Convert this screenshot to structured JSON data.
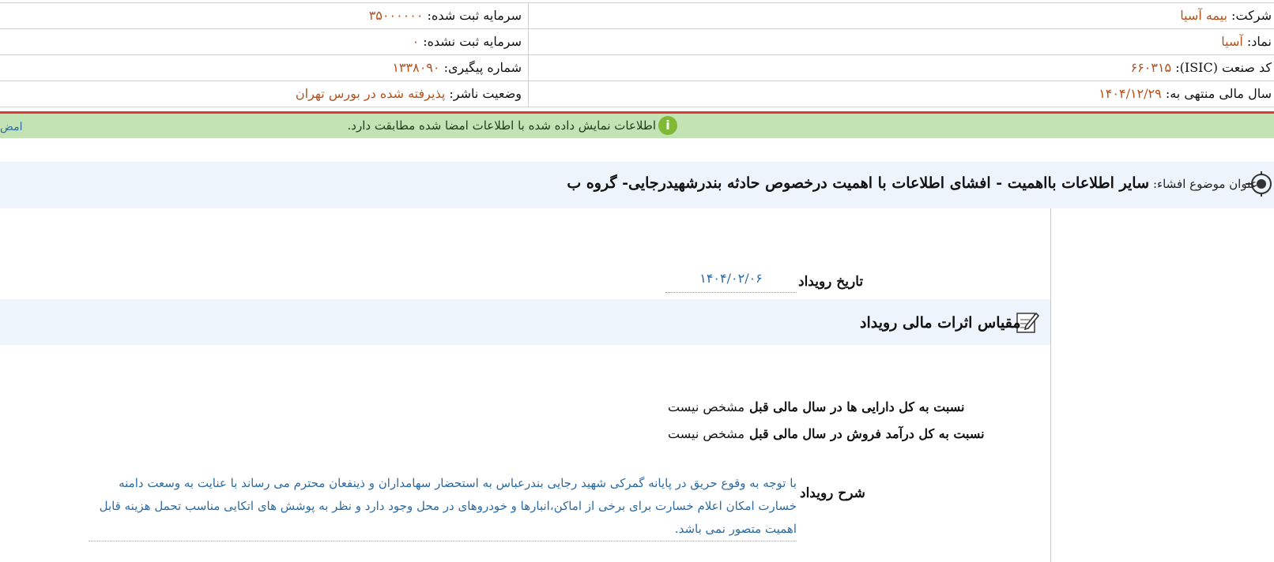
{
  "info": {
    "company_label": "شرکت:",
    "company_value": "بیمه آسیا",
    "symbol_label": "نماد:",
    "symbol_value": "آسیا",
    "isic_label": "کد صنعت (ISIC):",
    "isic_value": "۶۶۰۳۱۵",
    "fiscal_year_label": "سال مالی منتهی به:",
    "fiscal_year_value": "۱۴۰۴/۱۲/۲۹",
    "registered_capital_label": "سرمایه ثبت شده:",
    "registered_capital_value": "۳۵۰۰۰۰۰۰",
    "unregistered_capital_label": "سرمایه ثبت نشده:",
    "unregistered_capital_value": "۰",
    "tracking_number_label": "شماره پیگیری:",
    "tracking_number_value": "۱۳۳۸۰۹۰",
    "publisher_status_label": "وضعیت ناشر:",
    "publisher_status_value": "پذیرفته شده در بورس تهران"
  },
  "banner": {
    "text": "اطلاعات نمایش داده شده با اطلاعات امضا شده مطابقت دارد.",
    "side_link": "امض"
  },
  "disclosure": {
    "title_label": "عنوان موضوع افشاء:",
    "title_value": "سایر اطلاعات بااهمیت - افشای اطلاعات با اهمیت درخصوص حادثه بندرشهیدرجایی- گروه ب"
  },
  "event": {
    "date_label": "تاریخ رویداد",
    "date_value": "۱۴۰۴/۰۲/۰۶",
    "section_title": "مقیاس اثرات مالی رویداد",
    "ratio_assets_label": "نسبت به کل دارایی ها در سال مالی قبل",
    "ratio_assets_value": "مشخص نیست",
    "ratio_revenue_label": "نسبت به کل درآمد فروش در سال مالی قبل",
    "ratio_revenue_value": "مشخص نیست",
    "description_label": "شرح رویداد",
    "description_value": "با توجه به وقوع حریق در پایانه گمرکی شهید رجایی بندرعباس به استحضار سهامداران و ذینفعان محترم می رساند با عنایت به وسعت دامنه خسارت امکان اعلام خسارت برای برخی از اماکن،انبارها و خودروهای در محل وجود دارد و نظر به پوشش های اتکایی مناسب تحمل هزینه قابل اهمیت متصور نمی باشد."
  },
  "colors": {
    "value_text": "#b5521b",
    "link_blue": "#2b6ba3",
    "banner_green": "#c4e3b4",
    "alert_red": "#e0393b",
    "title_bg": "#eef4fb"
  }
}
